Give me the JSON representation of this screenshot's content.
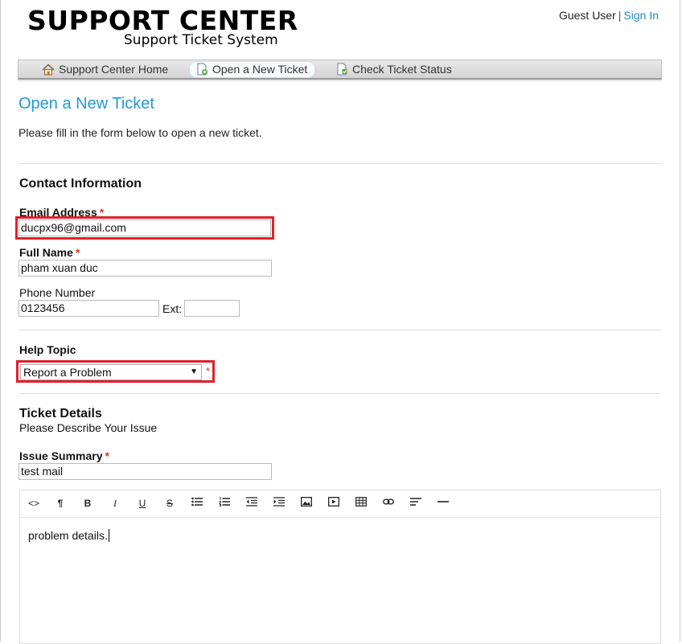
{
  "header": {
    "logo_title": "SUPPORT CENTER",
    "logo_subtitle": "Support Ticket System",
    "user_label": "Guest User",
    "separator": "|",
    "sign_in": "Sign In"
  },
  "nav": {
    "items": [
      {
        "label": "Support Center Home",
        "icon": "home-icon"
      },
      {
        "label": "Open a New Ticket",
        "icon": "new-ticket-icon",
        "active": true
      },
      {
        "label": "Check Ticket Status",
        "icon": "ticket-status-icon"
      }
    ]
  },
  "page": {
    "title": "Open a New Ticket",
    "intro": "Please fill in the form below to open a new ticket."
  },
  "contact": {
    "heading": "Contact Information",
    "email_label": "Email Address",
    "email_value": "ducpx96@gmail.com",
    "name_label": "Full Name",
    "name_value": "pham xuan duc",
    "phone_label": "Phone Number",
    "phone_value": "0123456",
    "ext_label": "Ext:",
    "ext_value": "",
    "required_mark": "*"
  },
  "help_topic": {
    "label": "Help Topic",
    "selected": "Report a Problem",
    "required_mark": "*"
  },
  "ticket": {
    "heading": "Ticket Details",
    "subheading": "Please Describe Your Issue",
    "summary_label": "Issue Summary",
    "summary_value": "test mail",
    "required_mark": "*",
    "body": "problem details."
  },
  "editor_toolbar": [
    "code-view-icon",
    "paragraph-icon",
    "bold-icon",
    "italic-icon",
    "underline-icon",
    "strikethrough-icon",
    "unordered-list-icon",
    "ordered-list-icon",
    "outdent-icon",
    "indent-icon",
    "image-icon",
    "video-icon",
    "table-icon",
    "link-icon",
    "align-left-icon",
    "horizontal-rule-icon"
  ],
  "colors": {
    "accent": "#1e9ad6",
    "highlight": "#e0212b",
    "required": "#dd3333"
  }
}
